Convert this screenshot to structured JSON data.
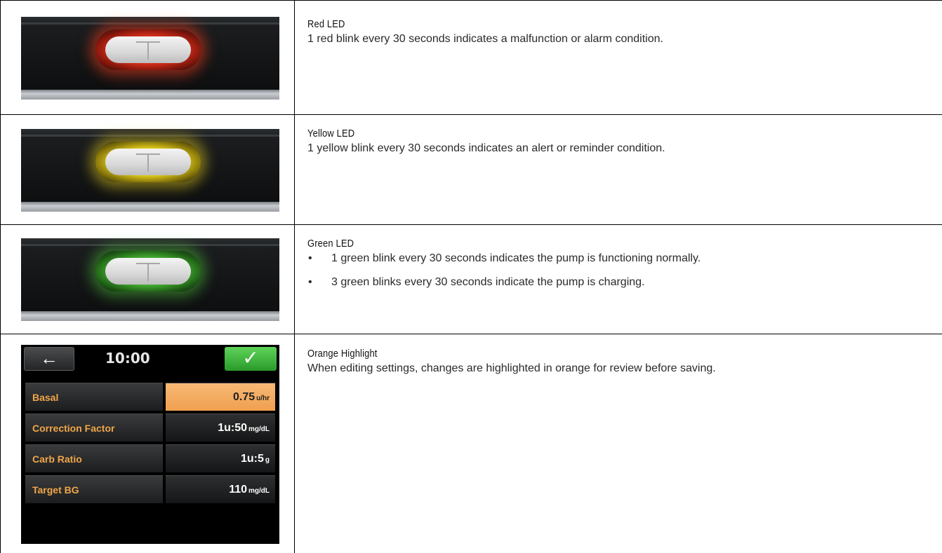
{
  "rows": [
    {
      "title": "Red LED",
      "desc": "1 red blink every 30 seconds indicates a malfunction or alarm condition.",
      "led_color": "#e0321e"
    },
    {
      "title": "Yellow LED",
      "desc": "1 yellow blink every 30 seconds indicates an alert or reminder condition.",
      "led_color": "#e8d21d"
    },
    {
      "title": "Green LED",
      "bullet1": "1 green blink every 30 seconds indicates the pump is functioning normally.",
      "bullet2": "3 green blinks every 30 seconds indicate the pump is charging.",
      "led_color": "#47b534"
    },
    {
      "title": "Orange Highlight",
      "desc": "When editing settings, changes are highlighted in orange for review before saving."
    }
  ],
  "bullet_glyph": "•",
  "screen": {
    "back_glyph": "←",
    "time": "10:00",
    "ok_glyph": "✓",
    "highlight_color": "#f7b876",
    "label_color": "#f0a64a",
    "settings": [
      {
        "label": "Basal",
        "value": "0.75",
        "unit": "u/hr",
        "highlighted": true
      },
      {
        "label": "Correction Factor",
        "value": "1u:50",
        "unit": "mg/dL",
        "highlighted": false
      },
      {
        "label": "Carb Ratio",
        "value": "1u:5",
        "unit": "g",
        "highlighted": false
      },
      {
        "label": "Target BG",
        "value": "110",
        "unit": "mg/dL",
        "highlighted": false
      }
    ]
  }
}
